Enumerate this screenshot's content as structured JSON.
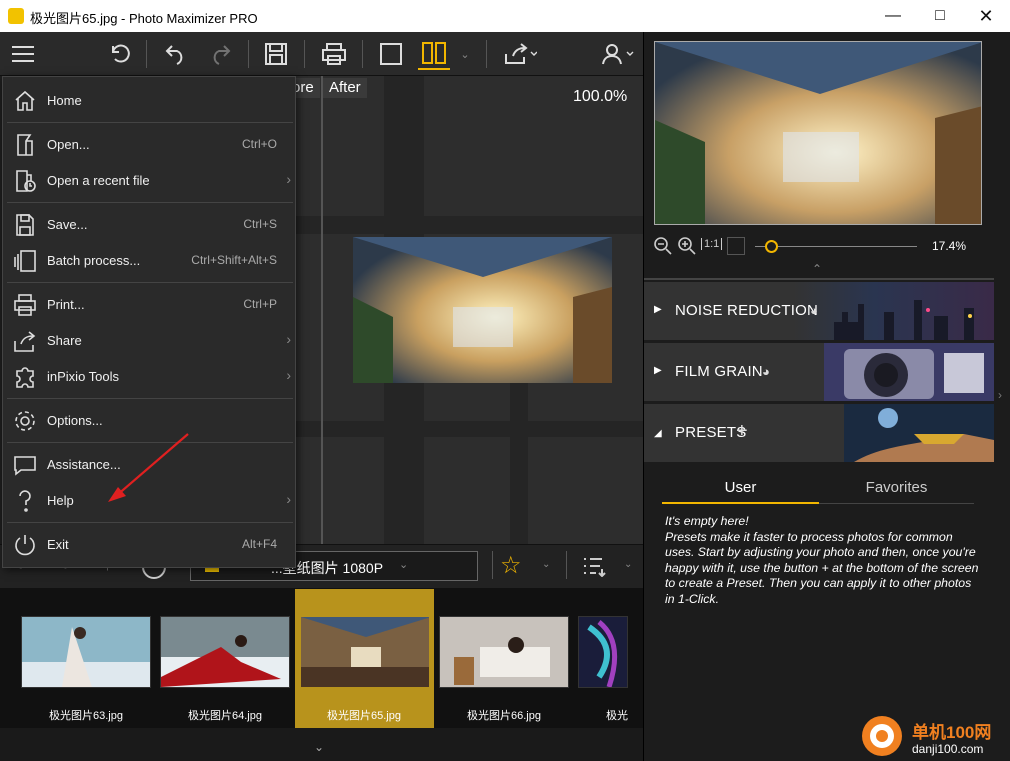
{
  "window": {
    "title": "极光图片65.jpg - Photo Maximizer PRO"
  },
  "canvas": {
    "before_label": "ore",
    "after_label": "After",
    "zoom": "100.0%"
  },
  "menu": {
    "items": [
      {
        "label": "Home",
        "shortcut": "",
        "icon": "home-icon"
      },
      {
        "label": "Open...",
        "shortcut": "Ctrl+O",
        "icon": "open-icon"
      },
      {
        "label": "Open a recent file",
        "shortcut": "",
        "icon": "recent-file-icon",
        "submenu": true
      },
      {
        "label": "Save...",
        "shortcut": "Ctrl+S",
        "icon": "save-icon"
      },
      {
        "label": "Batch process...",
        "shortcut": "Ctrl+Shift+Alt+S",
        "icon": "batch-icon"
      },
      {
        "label": "Print...",
        "shortcut": "Ctrl+P",
        "icon": "print-icon"
      },
      {
        "label": "Share",
        "shortcut": "",
        "icon": "share-icon",
        "submenu": true
      },
      {
        "label": "inPixio Tools",
        "shortcut": "",
        "icon": "puzzle-icon",
        "submenu": true
      },
      {
        "label": "Options...",
        "shortcut": "",
        "icon": "gear-icon"
      },
      {
        "label": "Assistance...",
        "shortcut": "",
        "icon": "chat-icon"
      },
      {
        "label": "Help",
        "shortcut": "",
        "icon": "help-icon",
        "submenu": true
      },
      {
        "label": "Exit",
        "shortcut": "Alt+F4",
        "icon": "power-icon"
      }
    ]
  },
  "filmstrip": {
    "folder": "...壁纸图片 1080P",
    "items": [
      {
        "caption": "极光图片63.jpg"
      },
      {
        "caption": "极光图片64.jpg"
      },
      {
        "caption": "极光图片65.jpg",
        "selected": true
      },
      {
        "caption": "极光图片66.jpg"
      },
      {
        "caption": "极光"
      }
    ]
  },
  "navigator": {
    "zoom": "17.4%"
  },
  "panels": [
    {
      "title": "NOISE REDUCTION",
      "expanded": false
    },
    {
      "title": "FILM GRAIN",
      "expanded": false
    },
    {
      "title": "PRESETS",
      "expanded": true
    }
  ],
  "presets": {
    "tabs": [
      "User",
      "Favorites"
    ],
    "active_tab": "User",
    "empty_title": "It's empty here!",
    "empty_body": "Presets make it faster to process photos for common uses. Start by adjusting your photo and then, once you're happy with it, use the button + at the bottom of the screen to create a Preset. Then you can apply it to other photos in 1-Click."
  },
  "watermark": {
    "line1": "单机100网",
    "line2": "danji100.com"
  },
  "colors": {
    "accent": "#f2b600",
    "menu_bg": "#2a2a2a",
    "arrow": "#e02020"
  }
}
